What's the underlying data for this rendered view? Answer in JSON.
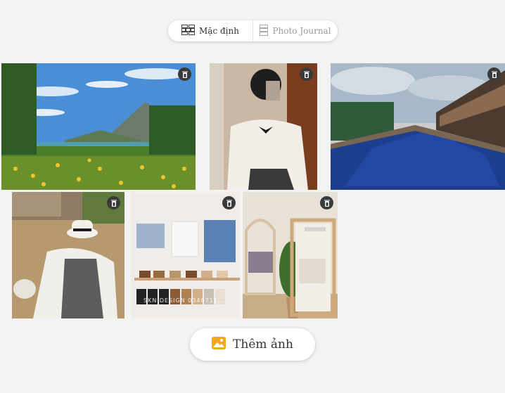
{
  "layout_toggle": {
    "default_label": "Mặc định",
    "journal_label": "Photo Journal"
  },
  "photos": [
    {
      "subject": "mountain meadow with yellow flowers"
    },
    {
      "subject": "girl taking mirror selfie"
    },
    {
      "subject": "resort swimming pool"
    },
    {
      "subject": "girl in plaid dress with hat"
    },
    {
      "subject": "clothing shop wall display",
      "watermark": "SKN DESIGN 0348711..."
    },
    {
      "subject": "boutique interior with plant"
    }
  ],
  "add_photo": {
    "label": "Thêm ảnh"
  },
  "colors": {
    "accent": "#f5a623",
    "trash_bg": "#3a3a3a",
    "background": "#f3f3f3"
  }
}
